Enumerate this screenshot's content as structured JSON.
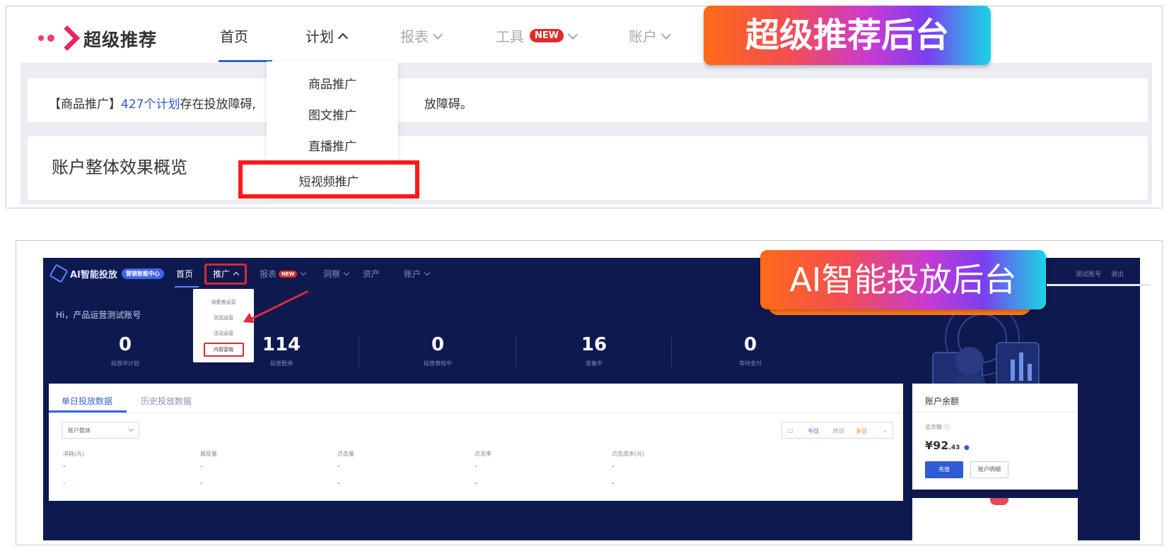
{
  "panel1": {
    "brand": "超级推荐",
    "nav": {
      "home": "首页",
      "plan": "计划",
      "report": "报表",
      "tools": "工具",
      "tools_badge": "NEW",
      "account": "账户"
    },
    "alert": {
      "prefix": "【商品推广】",
      "link": "427个计划",
      "text_before_dropdown": "存在投放障碍,",
      "text_after_dropdown": "放障碍。"
    },
    "overview_title": "账户整体效果概览",
    "dropdown": [
      "商品推广",
      "图文推广",
      "直播推广"
    ],
    "dropdown_highlighted": "短视频推广",
    "banner": "超级推荐后台"
  },
  "panel2": {
    "brand": "AI智能投放",
    "brand_pill": "营销智能中心",
    "nav": {
      "home": "首页",
      "promote": "推广",
      "report": "报表",
      "report_badge": "NEW",
      "assets": "洞察",
      "material": "资产",
      "account": "账户"
    },
    "right_links": [
      "测试账号",
      "退出"
    ],
    "greeting": "Hi，产品运营测试账号",
    "stats": [
      {
        "value": "0",
        "label": "投放中计划"
      },
      {
        "value": "114",
        "label": "投放暂停"
      },
      {
        "value": "0",
        "label": "投放审核中"
      },
      {
        "value": "16",
        "label": "准备中"
      },
      {
        "value": "0",
        "label": "等待支付"
      }
    ],
    "dropdown": [
      "消费者运营",
      "货品运营",
      "活动运营"
    ],
    "dropdown_highlighted": "内容营销",
    "tabs": [
      "单日投放数据",
      "历史投放数据"
    ],
    "select_value": "账户整体",
    "date_options": [
      "今日",
      "昨日",
      "多日"
    ],
    "columns": [
      "消耗(元)",
      "展现量",
      "点击量",
      "点击率",
      "点击成本(元)"
    ],
    "rows": [
      [
        "-",
        "-",
        "-",
        "-",
        "-"
      ],
      [
        "-",
        "-",
        "-",
        "-",
        "-"
      ]
    ],
    "side": {
      "title": "账户余额",
      "balance_label": "总余额",
      "balance_main": "¥92",
      "balance_decimal": ".43",
      "btn_recharge": "充值",
      "btn_detail": "账户明细"
    },
    "banner": "AI智能投放后台"
  },
  "colors": {
    "accent_blue": "#3060d8",
    "brand_pink": "#e8255f",
    "highlight_red": "#ff1a1a",
    "dark_navy": "#0e1a4f"
  }
}
